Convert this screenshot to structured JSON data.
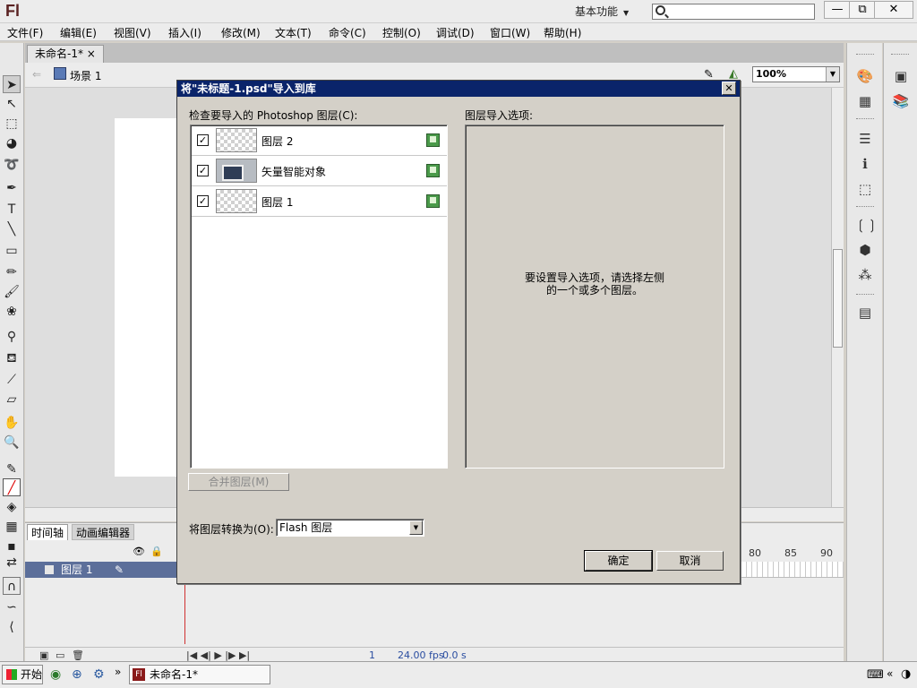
{
  "app": {
    "logo": "Fl",
    "workspace": "基本功能",
    "search": {
      "placeholder": "",
      "value": ""
    },
    "window_buttons": {
      "minimize": "—",
      "restore": "⧉",
      "close": "✕"
    }
  },
  "menu": [
    "文件(F)",
    "编辑(E)",
    "视图(V)",
    "插入(I)",
    "修改(M)",
    "文本(T)",
    "命令(C)",
    "控制(O)",
    "调试(D)",
    "窗口(W)",
    "帮助(H)"
  ],
  "document": {
    "tab_label": "未命名-1*",
    "tab_close": "×",
    "scene": "场景 1",
    "zoom": "100%"
  },
  "timeline": {
    "tabs": [
      "时间轴",
      "动画编辑器"
    ],
    "layer_name": "图层 1",
    "frame_numbers": [
      "80",
      "85",
      "90"
    ],
    "current_frame": "1",
    "fps": "24.00 fps",
    "elapsed": "0.0 s"
  },
  "taskbar": {
    "start_label": "开始",
    "task_label": "未命名-1*"
  },
  "dialog": {
    "title": "将\"未标题-1.psd\"导入到库",
    "close_glyph": "✕",
    "layers_label": "检查要导入的 Photoshop 图层(C):",
    "layers": [
      {
        "name": "图层 2",
        "checked": true,
        "check_glyph": "✓",
        "thumb": "checker"
      },
      {
        "name": "矢量智能对象",
        "checked": true,
        "check_glyph": "✓",
        "thumb": "image"
      },
      {
        "name": "图层 1",
        "checked": true,
        "check_glyph": "✓",
        "thumb": "checker"
      }
    ],
    "options_label": "图层导入选项:",
    "options_hint_line1": "要设置导入选项，请选择左侧",
    "options_hint_line2": "的一个或多个图层。",
    "merge_button": "合并图层(M)",
    "convert_label": "将图层转换为(O):",
    "convert_value": "Flash 图层",
    "ok_button": "确定",
    "cancel_button": "取消"
  },
  "colors": {
    "dialog_title_bg": "#0a246a",
    "selected_layer_bg": "#5c6f9a",
    "layer_icon_green": "#4a9a4a",
    "playhead": "#d03030"
  }
}
